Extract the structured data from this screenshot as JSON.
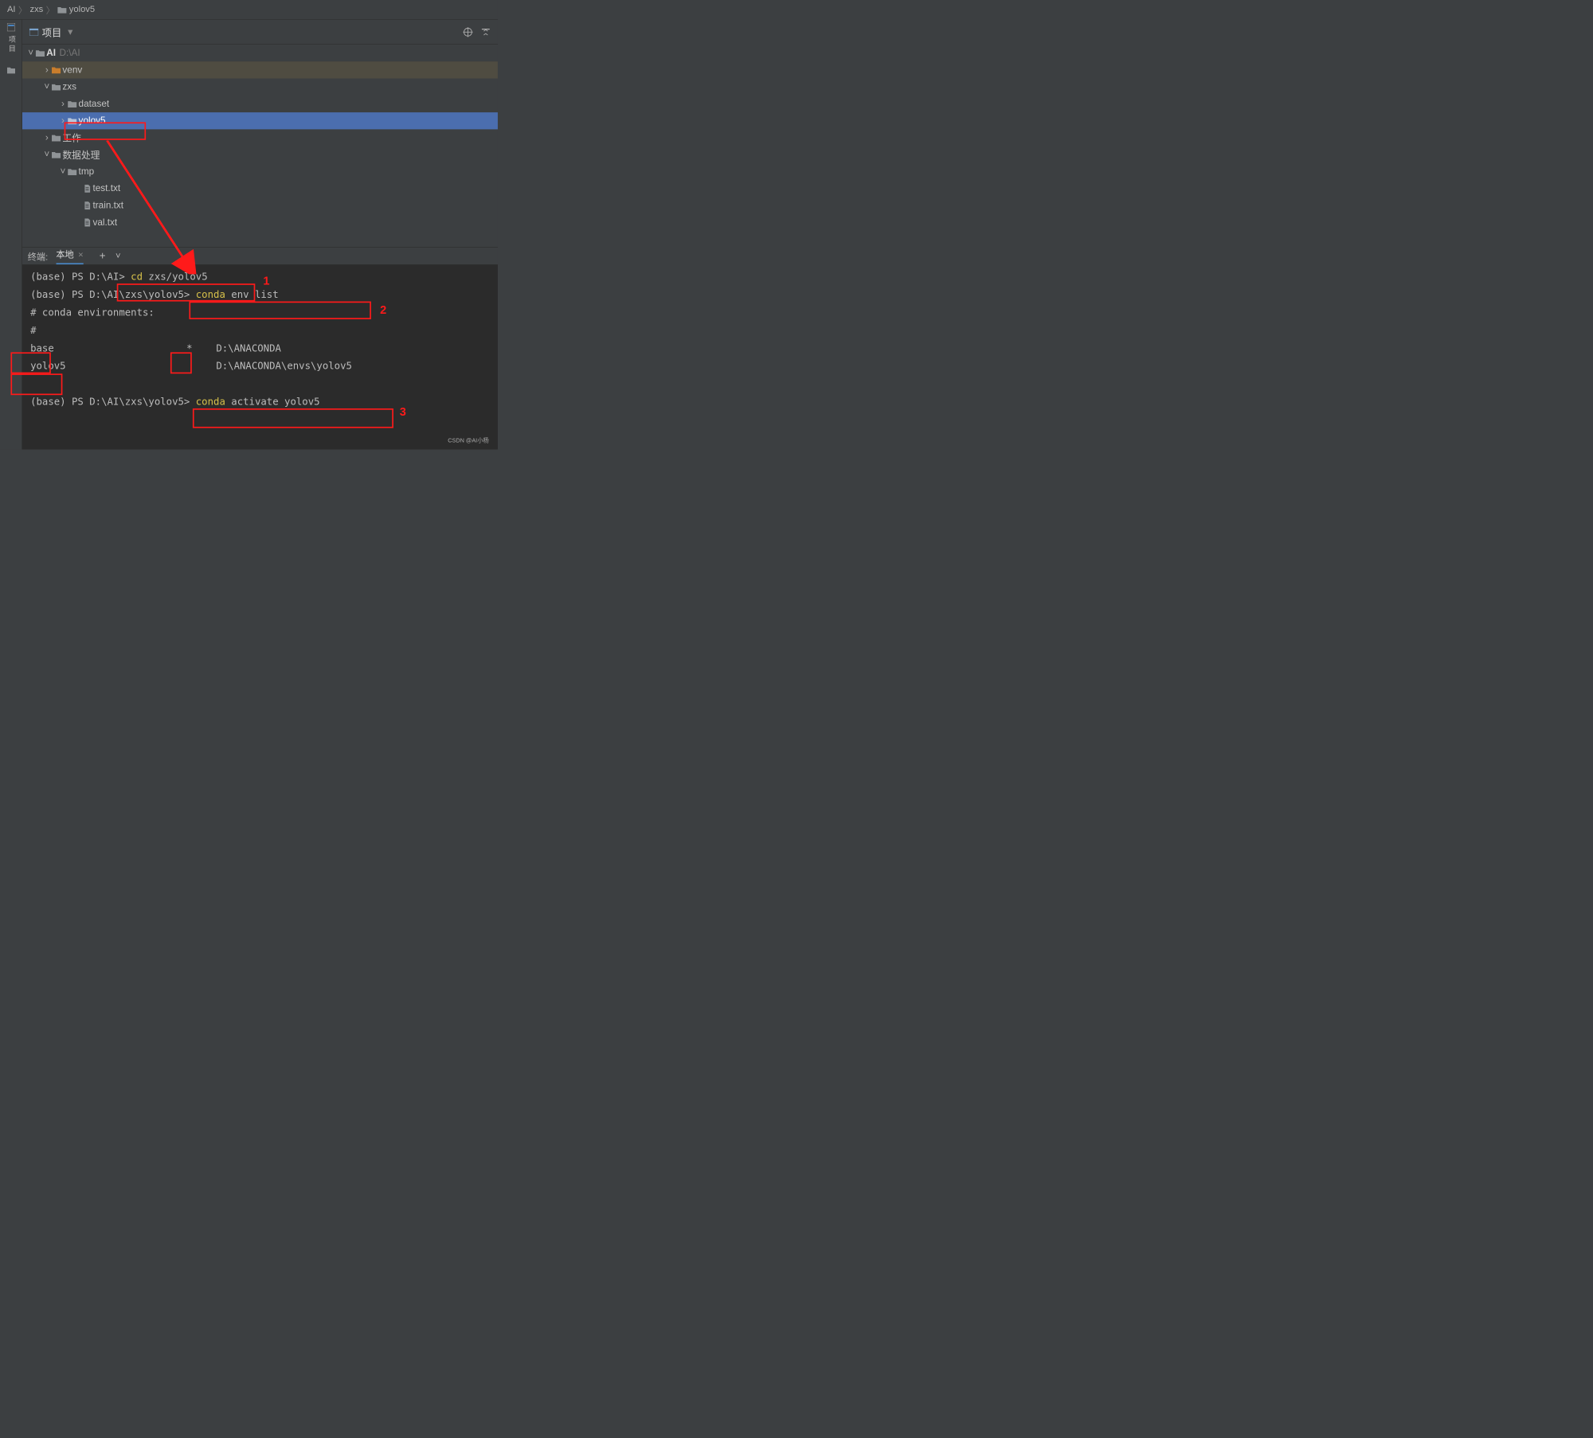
{
  "breadcrumb": {
    "a": "AI",
    "b": "zxs",
    "c": "yolov5"
  },
  "panel": {
    "title": "项目"
  },
  "gutter": {
    "label": "项目"
  },
  "tree": {
    "root": "AI",
    "root_path": "D:\\AI",
    "venv": "venv",
    "zxs": "zxs",
    "dataset": "dataset",
    "yolov5": "yolov5",
    "work": "工作",
    "dataproc": "数据处理",
    "tmp": "tmp",
    "test": "test.txt",
    "train": "train.txt",
    "val": "val.txt"
  },
  "terminal": {
    "header_label": "终端:",
    "tab": "本地",
    "l1_prompt": "(base) PS D:\\AI> ",
    "l1_cmd": "cd",
    "l1_rest": " zxs/yolov5",
    "l2_prompt": "(base) PS D:\\AI\\zxs\\yolov5> ",
    "l2_cmd": "conda",
    "l2_rest": " env list",
    "l3": "# conda environments:",
    "l4": "#",
    "l5a": "base",
    "l5star": "*",
    "l5path": "D:\\ANACONDA",
    "l6a": "yolov5",
    "l6path": "D:\\ANACONDA\\envs\\yolov5",
    "l8_prompt": "(base) PS D:\\AI\\zxs\\yolov5> ",
    "l8_cmd": "conda",
    "l8_rest": " activate yolov5"
  },
  "annotations": {
    "n1": "1",
    "n2": "2",
    "n3": "3"
  },
  "watermark": "CSDN @AI小杨"
}
